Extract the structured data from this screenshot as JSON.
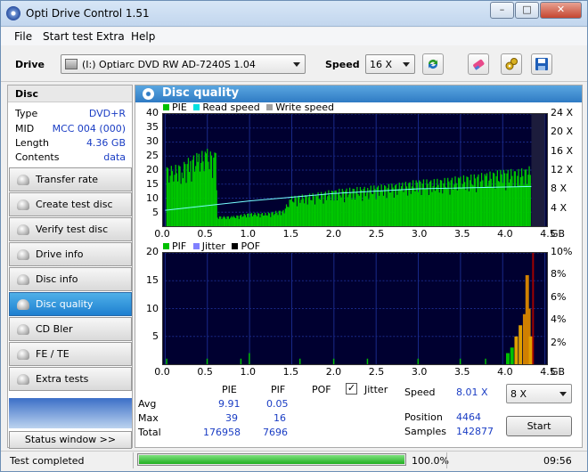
{
  "window": {
    "title": "Opti Drive Control 1.51",
    "minimize": "–",
    "maximize": "□",
    "close": "✕"
  },
  "menu": [
    "File",
    "Start test",
    "Extra",
    "Help"
  ],
  "toolbar": {
    "drive_label": "Drive",
    "drive_value": "(I:)   Optiarc DVD RW AD-7240S 1.04",
    "speed_label": "Speed",
    "speed_value": "16 X",
    "icons": [
      "refresh-icon",
      "erase-icon",
      "settings-icon",
      "save-icon"
    ]
  },
  "disc": {
    "header": "Disc",
    "rows": [
      {
        "k": "Type",
        "v": "DVD+R"
      },
      {
        "k": "MID",
        "v": "MCC 004 (000)"
      },
      {
        "k": "Length",
        "v": "4.36 GB"
      },
      {
        "k": "Contents",
        "v": "data"
      }
    ]
  },
  "nav": [
    {
      "label": "Transfer rate",
      "active": false
    },
    {
      "label": "Create test disc",
      "active": false
    },
    {
      "label": "Verify test disc",
      "active": false
    },
    {
      "label": "Drive info",
      "active": false
    },
    {
      "label": "Disc info",
      "active": false
    },
    {
      "label": "Disc quality",
      "active": true
    },
    {
      "label": "CD Bler",
      "active": false
    },
    {
      "label": "FE / TE",
      "active": false
    },
    {
      "label": "Extra tests",
      "active": false
    }
  ],
  "status_window_button": "Status window >>",
  "panel_title": "Disc quality",
  "chart_data": [
    {
      "type": "area",
      "legend": [
        {
          "name": "PIE",
          "color": "#00c000"
        },
        {
          "name": "Read speed",
          "color": "#00e0e0"
        },
        {
          "name": "Write speed",
          "color": "#a0a0a0"
        }
      ],
      "xlabel": "GB",
      "x_ticks": [
        "0.0",
        "0.5",
        "1.0",
        "1.5",
        "2.0",
        "2.5",
        "3.0",
        "3.5",
        "4.0",
        "4.5"
      ],
      "xlim": [
        0,
        4.5
      ],
      "y_ticks": [
        "5",
        "10",
        "15",
        "20",
        "25",
        "30",
        "35",
        "40"
      ],
      "ylim": [
        0,
        40
      ],
      "y2_ticks": [
        "4 X",
        "8 X",
        "12 X",
        "16 X",
        "20 X",
        "24 X"
      ],
      "y2lim": [
        0,
        24
      ],
      "pie": [
        [
          0.02,
          18
        ],
        [
          0.1,
          18
        ],
        [
          0.2,
          19
        ],
        [
          0.3,
          21
        ],
        [
          0.4,
          22
        ],
        [
          0.5,
          23
        ],
        [
          0.6,
          22
        ],
        [
          0.62,
          3
        ],
        [
          0.8,
          3
        ],
        [
          1.0,
          4
        ],
        [
          1.2,
          4
        ],
        [
          1.4,
          5
        ],
        [
          1.5,
          9
        ],
        [
          1.8,
          10
        ],
        [
          2.0,
          11
        ],
        [
          2.4,
          12
        ],
        [
          2.8,
          13
        ],
        [
          3.0,
          14
        ],
        [
          3.2,
          14
        ],
        [
          3.5,
          15
        ],
        [
          3.8,
          16
        ],
        [
          4.0,
          17
        ],
        [
          4.2,
          17
        ],
        [
          4.34,
          18
        ]
      ],
      "read_speed": [
        [
          0.0,
          3.4
        ],
        [
          1.0,
          5.4
        ],
        [
          2.0,
          7.0
        ],
        [
          3.0,
          8.0
        ],
        [
          4.34,
          8.5
        ]
      ]
    },
    {
      "type": "bar",
      "legend": [
        {
          "name": "PIF",
          "color": "#00c000"
        },
        {
          "name": "Jitter",
          "color": "#8080ff"
        },
        {
          "name": "POF",
          "color": "#000000"
        }
      ],
      "xlabel": "GB",
      "x_ticks": [
        "0.0",
        "0.5",
        "1.0",
        "1.5",
        "2.0",
        "2.5",
        "3.0",
        "3.5",
        "4.0",
        "4.5"
      ],
      "xlim": [
        0,
        4.5
      ],
      "y_ticks": [
        "5",
        "10",
        "15",
        "20"
      ],
      "ylim": [
        0,
        20
      ],
      "y2_ticks": [
        "2%",
        "4%",
        "6%",
        "8%",
        "10%"
      ],
      "y2lim": [
        0,
        10
      ],
      "pif": [
        [
          0.02,
          1
        ],
        [
          0.5,
          1
        ],
        [
          0.9,
          1
        ],
        [
          1.0,
          2
        ],
        [
          1.6,
          1
        ],
        [
          2.0,
          1
        ],
        [
          2.4,
          1
        ],
        [
          3.0,
          1
        ],
        [
          3.5,
          1
        ],
        [
          3.8,
          1
        ],
        [
          4.05,
          2
        ],
        [
          4.1,
          3
        ],
        [
          4.15,
          5
        ],
        [
          4.2,
          7
        ],
        [
          4.25,
          9
        ],
        [
          4.28,
          16
        ],
        [
          4.3,
          10
        ],
        [
          4.32,
          5
        ]
      ]
    }
  ],
  "stats": {
    "col_pie": "PIE",
    "col_pif": "PIF",
    "col_pof": "POF",
    "jitter": "Jitter",
    "jitter_checked": "✓",
    "avg_label": "Avg",
    "avg_pie": "9.91",
    "avg_pif": "0.05",
    "max_label": "Max",
    "max_pie": "39",
    "max_pif": "16",
    "total_label": "Total",
    "total_pie": "176958",
    "total_pif": "7696",
    "speed_label": "Speed",
    "speed_value": "8.01 X",
    "speed_select": "8 X",
    "position_label": "Position",
    "position_value": "4464",
    "samples_label": "Samples",
    "samples_value": "142877",
    "start": "Start"
  },
  "statusbar": {
    "text": "Test completed",
    "progress": 1.0,
    "progress_text": "100.0%",
    "time": "09:56"
  }
}
